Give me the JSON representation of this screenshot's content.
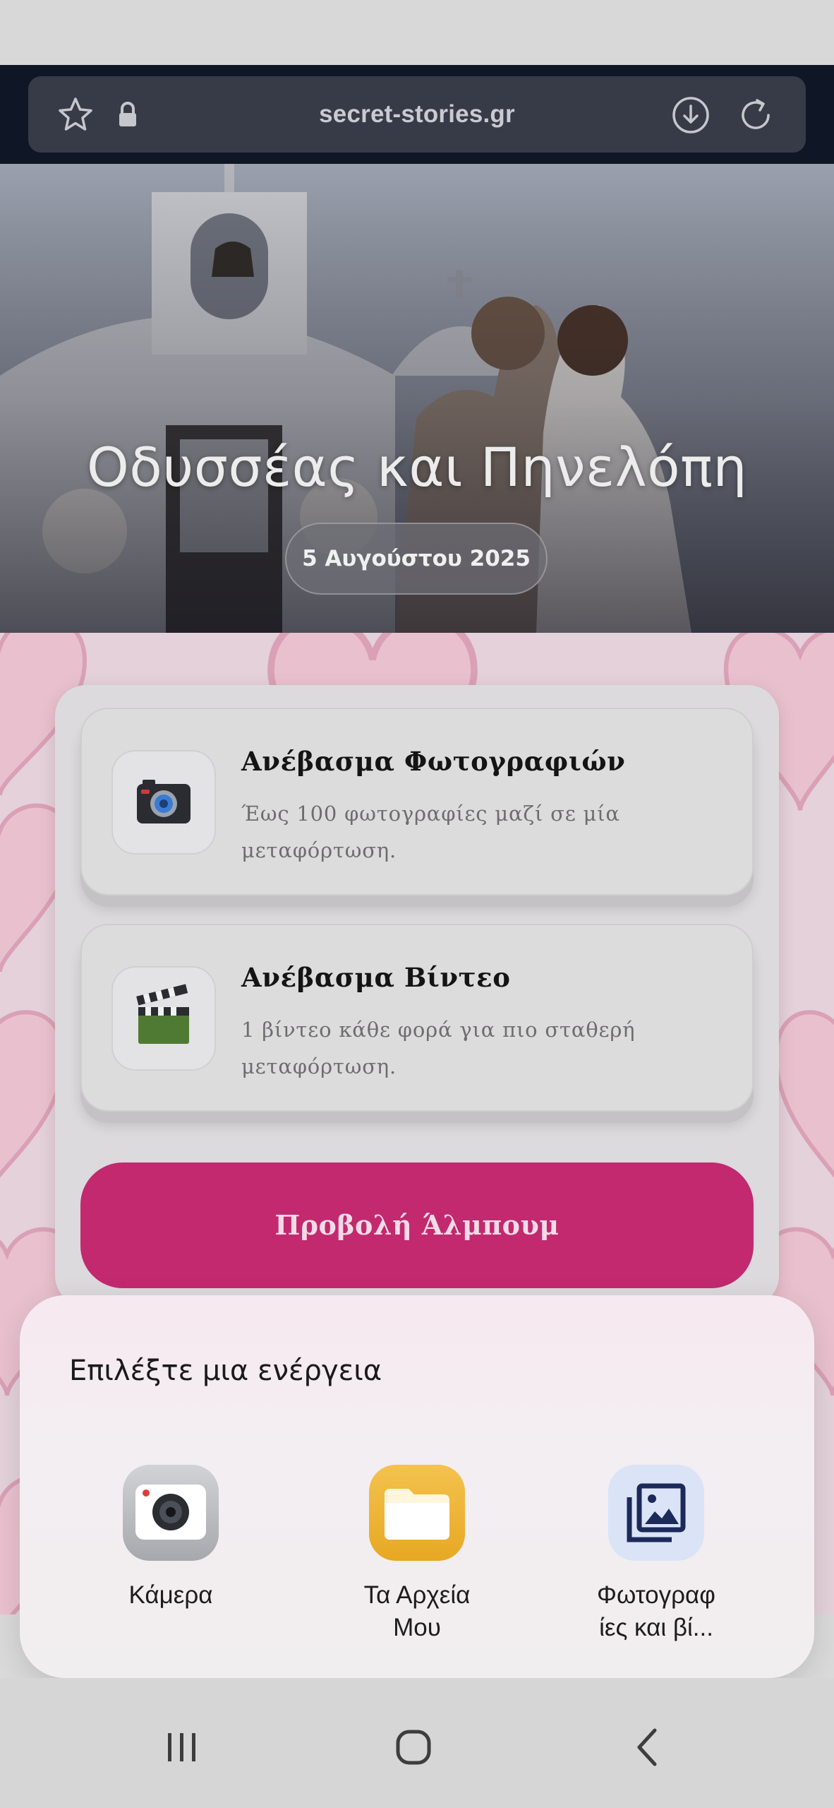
{
  "browser": {
    "url": "secret-stories.gr",
    "icons": [
      "star-icon",
      "lock-icon",
      "download-icon",
      "reload-icon"
    ]
  },
  "hero": {
    "title": "Οδυσσέας και Πηνελόπη",
    "date": "5 Αυγούστου 2025"
  },
  "upload": {
    "photos": {
      "title": "Ανέβασμα Φωτογραφιών",
      "description": "Έως 100 φωτογραφίες μαζί σε μία μεταφόρτωση.",
      "icon": "camera-icon"
    },
    "video": {
      "title": "Ανέβασμα Βίντεο",
      "description": "1 βίντεο κάθε φορά για πιο σταθερή μεταφόρτωση.",
      "icon": "clapperboard-icon"
    },
    "album_button": "Προβολή Άλμπουμ"
  },
  "sheet": {
    "title": "Επιλέξτε μια ενέργεια",
    "actions": [
      {
        "label": "Κάμερα",
        "icon": "camera-app-icon"
      },
      {
        "label": "Τα Αρχεία Μου",
        "icon": "folder-icon"
      },
      {
        "label": "Φωτογραφ ίες και βί...",
        "icon": "gallery-icon"
      }
    ]
  },
  "colors": {
    "accent": "#c2296f",
    "browser_bg": "#0f1626",
    "url_pill": "#373b48",
    "page_bg": "#e4d1d9"
  },
  "navigation": [
    "recents-button",
    "home-button",
    "back-button"
  ]
}
